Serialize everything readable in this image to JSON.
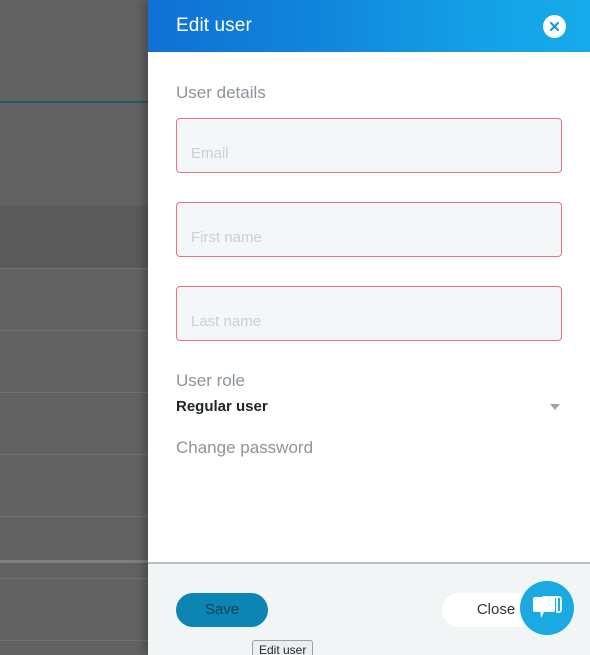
{
  "modal": {
    "title": "Edit user",
    "close_icon": "close-circle-icon",
    "header_color_left": "#1071d4",
    "header_color_right": "#16abea",
    "sections": {
      "user_details_label": "User details",
      "user_role_label": "User role",
      "change_password_label": "Change password"
    },
    "fields": [
      {
        "name": "email",
        "placeholder": "Email",
        "value": "",
        "invalid": true,
        "border_color": "#e8737f"
      },
      {
        "name": "first_name",
        "placeholder": "First name",
        "value": "",
        "invalid": true,
        "border_color": "#e8737f"
      },
      {
        "name": "last_name",
        "placeholder": "Last name",
        "value": "",
        "invalid": true,
        "border_color": "#e8737f"
      }
    ],
    "role_select": {
      "selected": "Regular user",
      "caret_icon": "chevron-down-icon"
    },
    "footer": {
      "save_label": "Save",
      "save_color": "#0c84b4",
      "close_label": "Close",
      "close_color": "#ffffff"
    }
  },
  "tooltip": {
    "text": "Edit user"
  },
  "chat_widget": {
    "icon": "chat-bubbles-icon",
    "color": "#1aa9e1"
  }
}
